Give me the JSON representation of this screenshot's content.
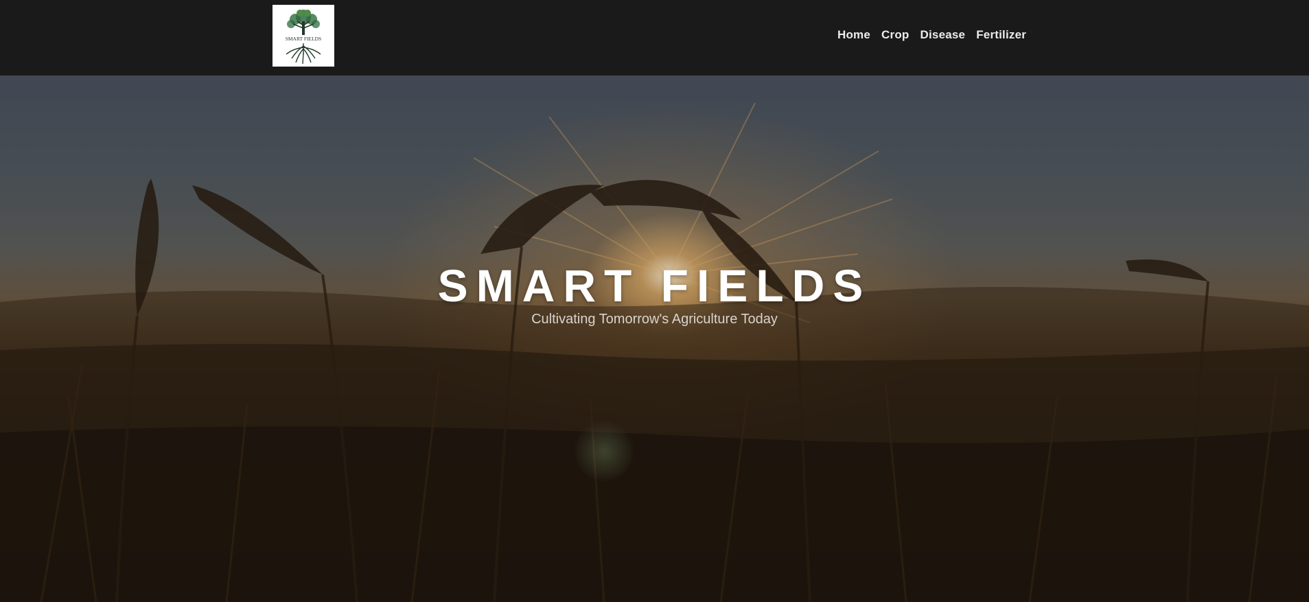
{
  "brand": {
    "logo_text": "SMART FIELDS",
    "logo_icon": "tree-roots-logo"
  },
  "nav": {
    "items": [
      {
        "label": "Home"
      },
      {
        "label": "Crop"
      },
      {
        "label": "Disease"
      },
      {
        "label": "Fertilizer"
      }
    ]
  },
  "hero": {
    "title": "SMART FIELDS",
    "subtitle": "Cultivating Tomorrow's Agriculture Today",
    "background": "wheat-field-sunset-image"
  },
  "colors": {
    "header_bg": "#1a1a1a",
    "nav_text": "#ececec",
    "logo_green": "#2f5b3a",
    "hero_text": "#ffffff"
  }
}
